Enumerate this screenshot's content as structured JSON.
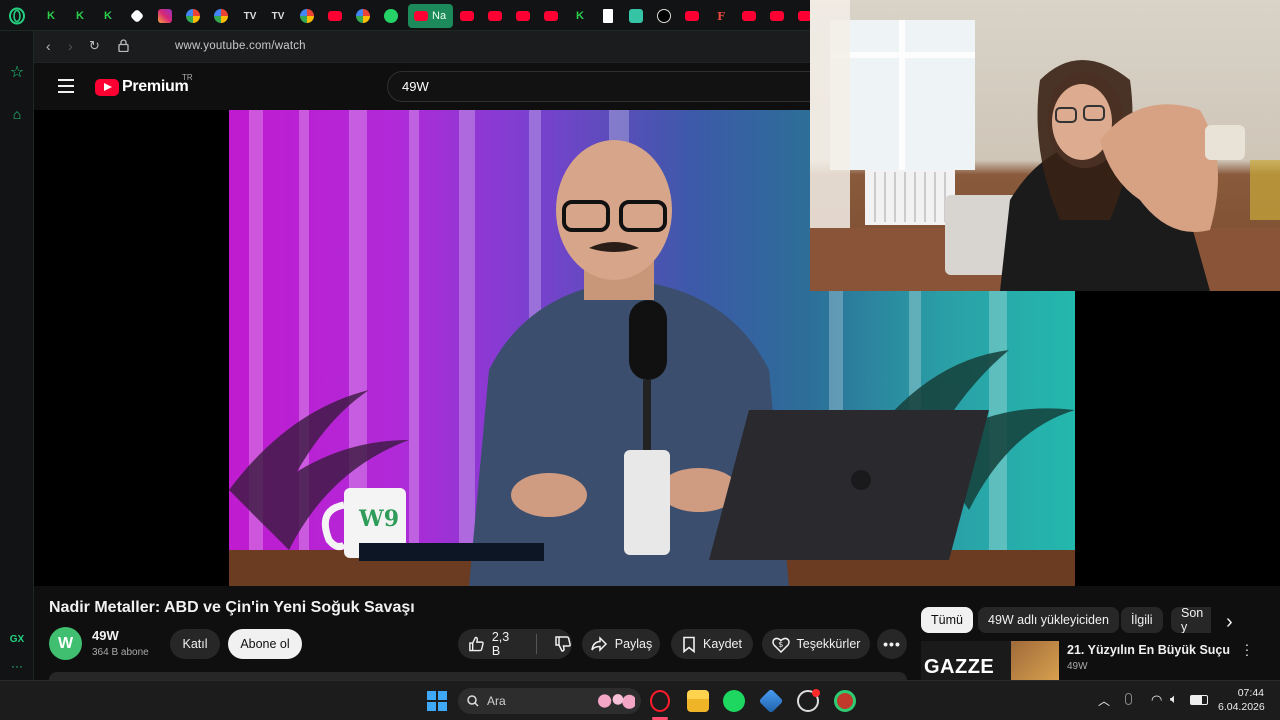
{
  "browser": {
    "tab_active_label": "Na",
    "url": "www.youtube.com/watch",
    "sidebar_gx_label": "GX"
  },
  "youtube": {
    "brand": "Premium",
    "country_code": "TR",
    "search_value": "49W",
    "video": {
      "title": "Nadir Metaller: ABD ve Çin'in Yeni Soğuk Savaşı",
      "mug_logo": "W9"
    },
    "channel": {
      "name": "49W",
      "subscribers": "364 B abone",
      "avatar_letter": "W"
    },
    "buttons": {
      "join": "Katıl",
      "subscribe": "Abone ol",
      "likes": "2,3 B",
      "share": "Paylaş",
      "save": "Kaydet",
      "thanks": "Teşekkürler"
    },
    "chips": [
      "Tümü",
      "49W adlı yükleyiciden",
      "İlgili",
      "Son y"
    ],
    "recommended": {
      "thumb_text": "GAZZE",
      "title": "21. Yüzyılın En Büyük Suçu",
      "channel": "49W"
    }
  },
  "taskbar": {
    "search_placeholder": "Ara",
    "time": "07:44",
    "date": "6.04.2026"
  },
  "colors": {
    "gx_accent": "#25d080",
    "yt_red": "#ff0033",
    "bg": "#0f0f0f"
  }
}
